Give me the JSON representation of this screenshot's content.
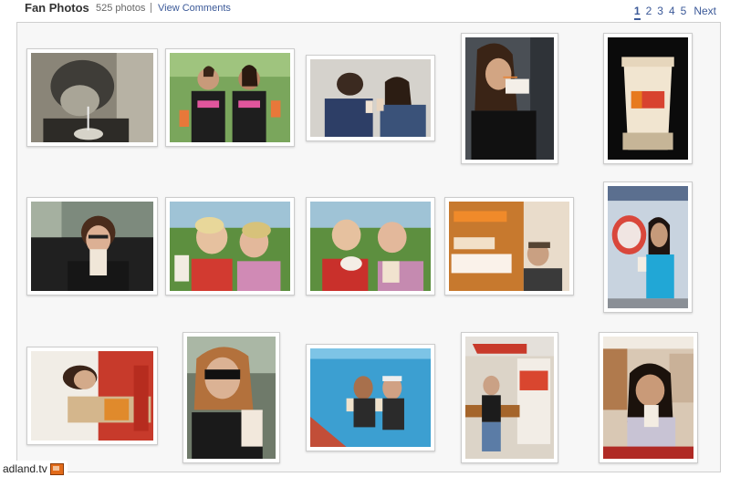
{
  "header": {
    "title": "Fan Photos",
    "count": "525 photos",
    "view_comments": "View Comments"
  },
  "pager": {
    "pages": [
      "1",
      "2",
      "3",
      "4",
      "5"
    ],
    "current": "1",
    "next": "Next"
  },
  "photos": [
    {
      "name": "photo-bw-girl-straw",
      "subject": "black-and-white person sipping drink through straw"
    },
    {
      "name": "photo-two-girls-shirts",
      "subject": "two people in Dunkin' shirts holding iced drinks"
    },
    {
      "name": "photo-couple-drinks",
      "subject": "couple posing with iced drinks"
    },
    {
      "name": "photo-girl-car-straw",
      "subject": "girl sipping drink in car"
    },
    {
      "name": "photo-dunkin-cup",
      "subject": "Dunkin' Donuts cup on black background"
    },
    {
      "name": "photo-girl-glasses-car",
      "subject": "girl with glasses drinking in car"
    },
    {
      "name": "photo-mother-son-1",
      "subject": "boy and woman with frozen drinks outdoors"
    },
    {
      "name": "photo-mother-son-2",
      "subject": "boy and woman sipping frozen drinks outdoors"
    },
    {
      "name": "photo-coolatta-sign",
      "subject": "man in front of Dunkin' Donuts Coffee Coolatta sign"
    },
    {
      "name": "photo-girl-storefront",
      "subject": "girl with drink in front of Dunkin' storefront"
    },
    {
      "name": "photo-giant-cup-rotated",
      "subject": "rotated photo of girl with giant Dunkin' cup"
    },
    {
      "name": "photo-sunglasses-woman",
      "subject": "woman in sunglasses with iced drink in car"
    },
    {
      "name": "photo-pool-friends",
      "subject": "friends in pool with frozen drinks"
    },
    {
      "name": "photo-bench-woman",
      "subject": "woman on bench beside Dunkin' Donuts cup display"
    },
    {
      "name": "photo-child-shop",
      "subject": "child drinking in Dunkin' shop"
    }
  ],
  "watermark": {
    "text": "adland.tv",
    "icon": "tv-icon"
  }
}
